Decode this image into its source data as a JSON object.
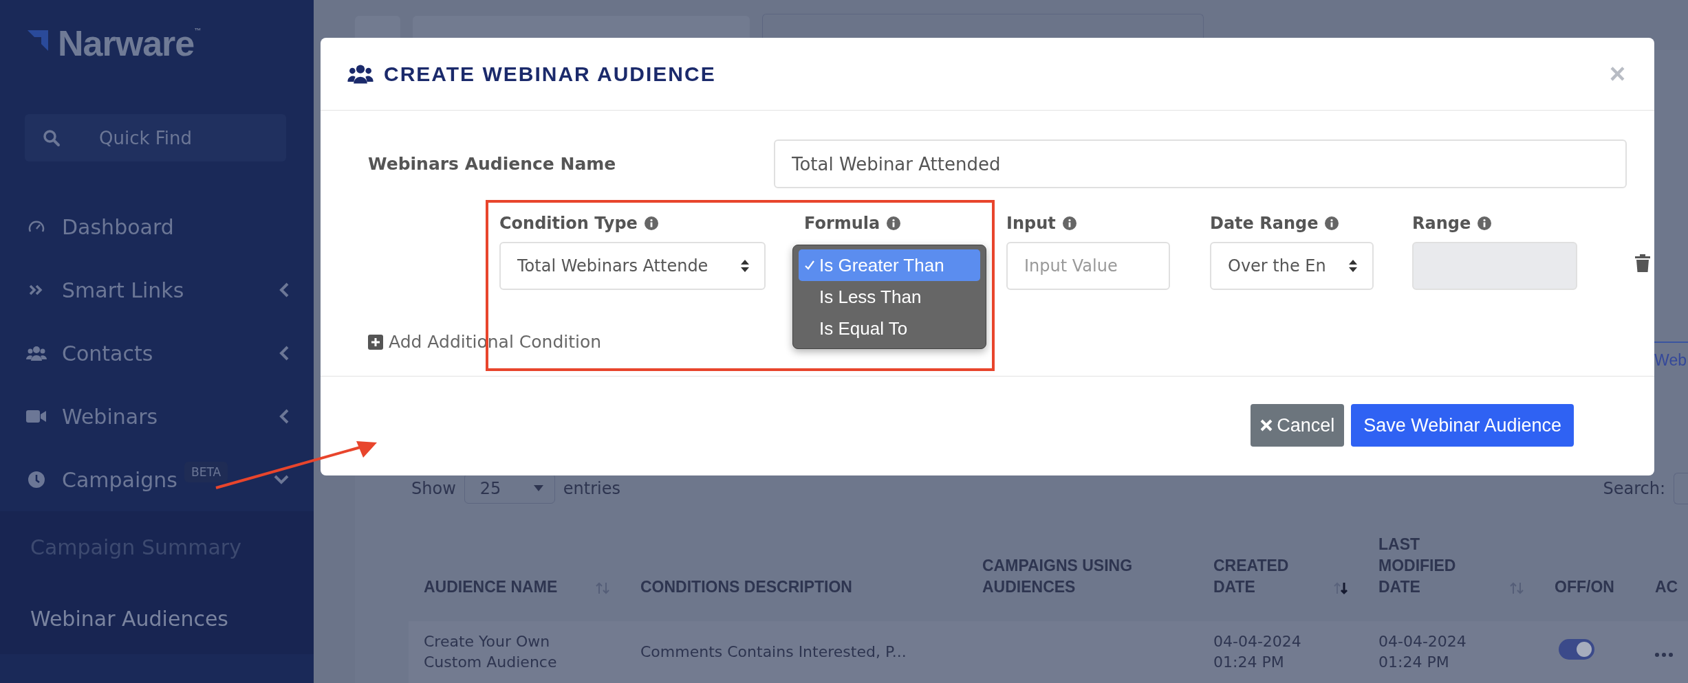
{
  "sidebar": {
    "logo": "Narware$^{™}$",
    "search": {
      "placeholder": "Quick Find"
    },
    "items": [
      {
        "label": "Dashboard",
        "kind": "link"
      },
      {
        "label": "Smart Links",
        "kind": "menu",
        "expanded": false
      },
      {
        "label": "Contacts",
        "kind": "menu",
        "expanded": false
      },
      {
        "label": "Webinars",
        "kind": "menu",
        "expanded": false
      },
      {
        "label": "Campaigns",
        "kind": "menu",
        "expanded": true,
        "badge": "BETA",
        "children": [
          {
            "label": "Campaign Summary",
            "selected": false
          },
          {
            "label": "Webinar Audiences",
            "selected": true
          }
        ]
      }
    ]
  },
  "page": {
    "tab_fragment": "Web",
    "entries": {
      "show": "Show",
      "value": "25",
      "suffix": "entries"
    },
    "search_label": "Search:",
    "table": {
      "columns": [
        {
          "label": "AUDIENCE NAME",
          "sortable": true,
          "sorted_desc": false
        },
        {
          "label": "CONDITIONS DESCRIPTION",
          "sortable": false
        },
        {
          "label": "CAMPAIGNS USING AUDIENCES",
          "sortable": false
        },
        {
          "label": "CREATED DATE",
          "sortable": true,
          "sorted_desc": true
        },
        {
          "label": "LAST MODIFIED DATE",
          "sortable": true,
          "sorted_desc": false
        },
        {
          "label": "OFF/ON",
          "sortable": false
        },
        {
          "label": "AC",
          "sortable": false
        }
      ],
      "rows": [
        {
          "cells": [
            "Create Your Own Custom Audience",
            "Comments Contains Interested, P...",
            "",
            "04-04-2024 01:24 PM",
            "04-04-2024 01:24 PM"
          ],
          "on": true
        }
      ]
    }
  },
  "modal": {
    "title": "CREATE WEBINAR AUDIENCE",
    "close": "×",
    "name_label": "Webinars Audience Name",
    "name_value": "Total Webinar Attended",
    "conditions": [
      {
        "label": "Condition Type",
        "kind": "select",
        "value": "Total Webinars Attende"
      },
      {
        "label": "Formula",
        "kind": "menu",
        "options": [
          {
            "label": "Is Greater Than",
            "selected": true
          },
          {
            "label": "Is Less Than",
            "selected": false
          },
          {
            "label": "Is Equal To",
            "selected": false
          }
        ]
      },
      {
        "label": "Input",
        "kind": "input",
        "placeholder": "Input Value"
      },
      {
        "label": "Date Range",
        "kind": "select",
        "value": "Over the En"
      },
      {
        "label": "Range",
        "kind": "disabled"
      }
    ],
    "add_condition": "Add Additional Condition",
    "cancel": "Cancel",
    "save": "Save Webinar Audience"
  },
  "annotations": {
    "highlight_frame": true,
    "arrow": true
  }
}
